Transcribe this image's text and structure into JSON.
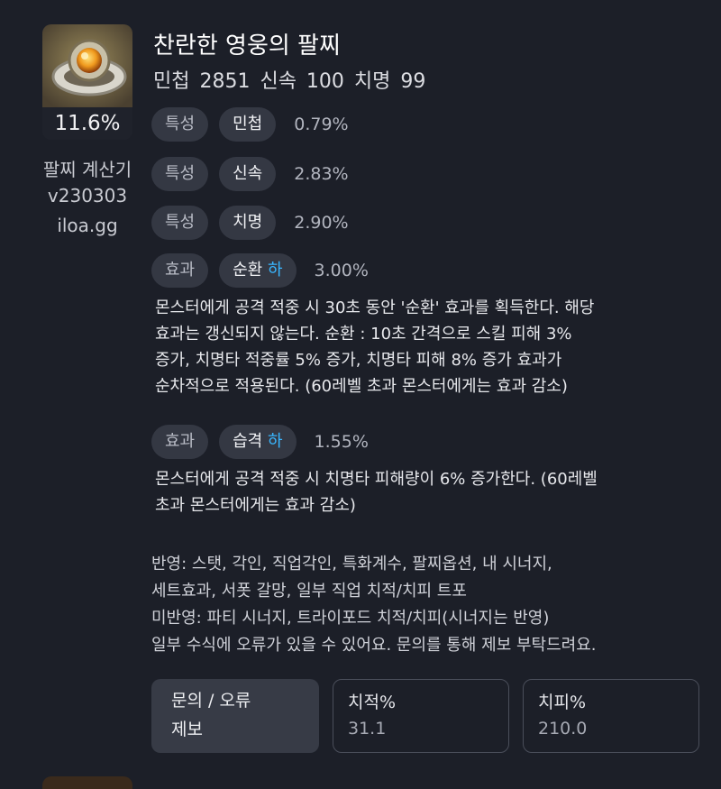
{
  "item": {
    "percent": "11.6%",
    "name": "찬란한 영웅의 팔찌",
    "stats_line": "민첩 2851  신속 100  치명 99"
  },
  "calculator": {
    "name": "팔찌 계산기",
    "version": "v230303",
    "site": "iloa.gg"
  },
  "options": [
    {
      "type": "특성",
      "name": "민첩",
      "grade": "",
      "value": "0.79%",
      "description": ""
    },
    {
      "type": "특성",
      "name": "신속",
      "grade": "",
      "value": "2.83%",
      "description": ""
    },
    {
      "type": "특성",
      "name": "치명",
      "grade": "",
      "value": "2.90%",
      "description": ""
    },
    {
      "type": "효과",
      "name": "순환",
      "grade": "하",
      "value": "3.00%",
      "description": [
        "몬스터에게 공격 적중 시 30초 동안 '순환' 효과를 획득한다. 해당",
        "효과는 갱신되지 않는다. 순환 : 10초 간격으로 스킬 피해 3%",
        "증가, 치명타 적중률 5% 증가, 치명타 피해 8% 증가 효과가",
        "순차적으로 적용된다. (60레벨 초과 몬스터에게는 효과 감소)"
      ]
    },
    {
      "type": "효과",
      "name": "습격",
      "grade": "하",
      "value": "1.55%",
      "description": [
        "몬스터에게 공격 적중 시 치명타 피해량이 6% 증가한다. (60레벨",
        "초과 몬스터에게는 효과 감소)"
      ]
    }
  ],
  "notes": [
    "반영: 스탯, 각인, 직업각인, 특화계수, 팔찌옵션, 내 시너지,",
    "세트효과, 서폿 갈망, 일부 직업 치적/치피 트포",
    "미반영: 파티 시너지, 트라이포드 치적/치피(시너지는 반영)",
    "일부 수식에 오류가 있을 수 있어요. 문의를 통해 제보 부탁드려요."
  ],
  "report_button": {
    "line1": "문의 / 오류",
    "line2": "제보"
  },
  "crit_rate": {
    "label": "치적%",
    "value": "31.1"
  },
  "crit_damage": {
    "label": "치피%",
    "value": "210.0"
  },
  "colors": {
    "background": "#1c1f28",
    "chip": "#343843",
    "grade_accent": "#39b6ff"
  }
}
